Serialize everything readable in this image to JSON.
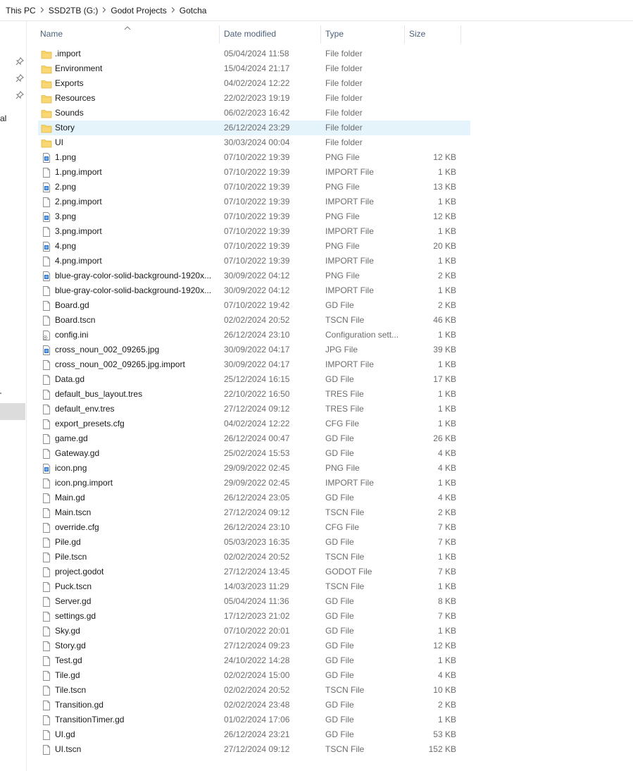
{
  "breadcrumb": [
    "This PC",
    "SSD2TB (G:)",
    "Godot Projects",
    "Gotcha"
  ],
  "nav": {
    "fragment_label": "al"
  },
  "columns": {
    "name": "Name",
    "date": "Date modified",
    "type": "Type",
    "size": "Size"
  },
  "colors": {
    "selected_row": "#e5f3fb",
    "folder": "#f8d775",
    "header_text": "#4c607a",
    "png_badge": "#1e6fd9"
  },
  "files": [
    {
      "name": ".import",
      "date": "05/04/2024 11:58",
      "type": "File folder",
      "size": "",
      "icon": "folder-icon"
    },
    {
      "name": "Environment",
      "date": "15/04/2024 21:17",
      "type": "File folder",
      "size": "",
      "icon": "folder-icon"
    },
    {
      "name": "Exports",
      "date": "04/02/2024 12:22",
      "type": "File folder",
      "size": "",
      "icon": "folder-icon"
    },
    {
      "name": "Resources",
      "date": "22/02/2023 19:19",
      "type": "File folder",
      "size": "",
      "icon": "folder-icon"
    },
    {
      "name": "Sounds",
      "date": "06/02/2023 16:42",
      "type": "File folder",
      "size": "",
      "icon": "folder-icon"
    },
    {
      "name": "Story",
      "date": "26/12/2024 23:29",
      "type": "File folder",
      "size": "",
      "icon": "folder-icon",
      "selected": true
    },
    {
      "name": "UI",
      "date": "30/03/2024 00:04",
      "type": "File folder",
      "size": "",
      "icon": "folder-icon"
    },
    {
      "name": "1.png",
      "date": "07/10/2022 19:39",
      "type": "PNG File",
      "size": "12 KB",
      "icon": "image-file-icon"
    },
    {
      "name": "1.png.import",
      "date": "07/10/2022 19:39",
      "type": "IMPORT File",
      "size": "1 KB",
      "icon": "file-icon"
    },
    {
      "name": "2.png",
      "date": "07/10/2022 19:39",
      "type": "PNG File",
      "size": "13 KB",
      "icon": "image-file-icon"
    },
    {
      "name": "2.png.import",
      "date": "07/10/2022 19:39",
      "type": "IMPORT File",
      "size": "1 KB",
      "icon": "file-icon"
    },
    {
      "name": "3.png",
      "date": "07/10/2022 19:39",
      "type": "PNG File",
      "size": "12 KB",
      "icon": "image-file-icon"
    },
    {
      "name": "3.png.import",
      "date": "07/10/2022 19:39",
      "type": "IMPORT File",
      "size": "1 KB",
      "icon": "file-icon"
    },
    {
      "name": "4.png",
      "date": "07/10/2022 19:39",
      "type": "PNG File",
      "size": "20 KB",
      "icon": "image-file-icon"
    },
    {
      "name": "4.png.import",
      "date": "07/10/2022 19:39",
      "type": "IMPORT File",
      "size": "1 KB",
      "icon": "file-icon"
    },
    {
      "name": "blue-gray-color-solid-background-1920x...",
      "date": "30/09/2022 04:12",
      "type": "PNG File",
      "size": "2 KB",
      "icon": "image-file-icon"
    },
    {
      "name": "blue-gray-color-solid-background-1920x...",
      "date": "30/09/2022 04:12",
      "type": "IMPORT File",
      "size": "1 KB",
      "icon": "file-icon"
    },
    {
      "name": "Board.gd",
      "date": "07/10/2022 19:42",
      "type": "GD File",
      "size": "2 KB",
      "icon": "file-icon"
    },
    {
      "name": "Board.tscn",
      "date": "02/02/2024 20:52",
      "type": "TSCN File",
      "size": "46 KB",
      "icon": "file-icon"
    },
    {
      "name": "config.ini",
      "date": "26/12/2024 23:10",
      "type": "Configuration sett...",
      "size": "1 KB",
      "icon": "settings-file-icon"
    },
    {
      "name": "cross_noun_002_09265.jpg",
      "date": "30/09/2022 04:17",
      "type": "JPG File",
      "size": "39 KB",
      "icon": "image-file-icon"
    },
    {
      "name": "cross_noun_002_09265.jpg.import",
      "date": "30/09/2022 04:17",
      "type": "IMPORT File",
      "size": "1 KB",
      "icon": "file-icon"
    },
    {
      "name": "Data.gd",
      "date": "25/12/2024 16:15",
      "type": "GD File",
      "size": "17 KB",
      "icon": "file-icon"
    },
    {
      "name": "default_bus_layout.tres",
      "date": "22/10/2022 16:50",
      "type": "TRES File",
      "size": "1 KB",
      "icon": "file-icon"
    },
    {
      "name": "default_env.tres",
      "date": "27/12/2024 09:12",
      "type": "TRES File",
      "size": "1 KB",
      "icon": "file-icon"
    },
    {
      "name": "export_presets.cfg",
      "date": "04/02/2024 12:22",
      "type": "CFG File",
      "size": "1 KB",
      "icon": "file-icon"
    },
    {
      "name": "game.gd",
      "date": "26/12/2024 00:47",
      "type": "GD File",
      "size": "26 KB",
      "icon": "file-icon"
    },
    {
      "name": "Gateway.gd",
      "date": "25/02/2024 15:53",
      "type": "GD File",
      "size": "4 KB",
      "icon": "file-icon"
    },
    {
      "name": "icon.png",
      "date": "29/09/2022 02:45",
      "type": "PNG File",
      "size": "4 KB",
      "icon": "image-file-icon"
    },
    {
      "name": "icon.png.import",
      "date": "29/09/2022 02:45",
      "type": "IMPORT File",
      "size": "1 KB",
      "icon": "file-icon"
    },
    {
      "name": "Main.gd",
      "date": "26/12/2024 23:05",
      "type": "GD File",
      "size": "4 KB",
      "icon": "file-icon"
    },
    {
      "name": "Main.tscn",
      "date": "27/12/2024 09:12",
      "type": "TSCN File",
      "size": "2 KB",
      "icon": "file-icon"
    },
    {
      "name": "override.cfg",
      "date": "26/12/2024 23:10",
      "type": "CFG File",
      "size": "7 KB",
      "icon": "file-icon"
    },
    {
      "name": "Pile.gd",
      "date": "05/03/2023 16:35",
      "type": "GD File",
      "size": "7 KB",
      "icon": "file-icon"
    },
    {
      "name": "Pile.tscn",
      "date": "02/02/2024 20:52",
      "type": "TSCN File",
      "size": "1 KB",
      "icon": "file-icon"
    },
    {
      "name": "project.godot",
      "date": "27/12/2024 13:45",
      "type": "GODOT File",
      "size": "7 KB",
      "icon": "file-icon"
    },
    {
      "name": "Puck.tscn",
      "date": "14/03/2023 11:29",
      "type": "TSCN File",
      "size": "1 KB",
      "icon": "file-icon"
    },
    {
      "name": "Server.gd",
      "date": "05/04/2024 11:36",
      "type": "GD File",
      "size": "8 KB",
      "icon": "file-icon"
    },
    {
      "name": "settings.gd",
      "date": "17/12/2023 21:02",
      "type": "GD File",
      "size": "7 KB",
      "icon": "file-icon"
    },
    {
      "name": "Sky.gd",
      "date": "07/10/2022 20:01",
      "type": "GD File",
      "size": "1 KB",
      "icon": "file-icon"
    },
    {
      "name": "Story.gd",
      "date": "27/12/2024 09:23",
      "type": "GD File",
      "size": "12 KB",
      "icon": "file-icon"
    },
    {
      "name": "Test.gd",
      "date": "24/10/2022 14:28",
      "type": "GD File",
      "size": "1 KB",
      "icon": "file-icon"
    },
    {
      "name": "Tile.gd",
      "date": "02/02/2024 15:00",
      "type": "GD File",
      "size": "4 KB",
      "icon": "file-icon"
    },
    {
      "name": "Tile.tscn",
      "date": "02/02/2024 20:52",
      "type": "TSCN File",
      "size": "10 KB",
      "icon": "file-icon"
    },
    {
      "name": "Transition.gd",
      "date": "02/02/2024 23:48",
      "type": "GD File",
      "size": "2 KB",
      "icon": "file-icon"
    },
    {
      "name": "TransitionTimer.gd",
      "date": "01/02/2024 17:06",
      "type": "GD File",
      "size": "1 KB",
      "icon": "file-icon"
    },
    {
      "name": "UI.gd",
      "date": "26/12/2024 23:21",
      "type": "GD File",
      "size": "53 KB",
      "icon": "file-icon"
    },
    {
      "name": "UI.tscn",
      "date": "27/12/2024 09:12",
      "type": "TSCN File",
      "size": "152 KB",
      "icon": "file-icon"
    }
  ]
}
